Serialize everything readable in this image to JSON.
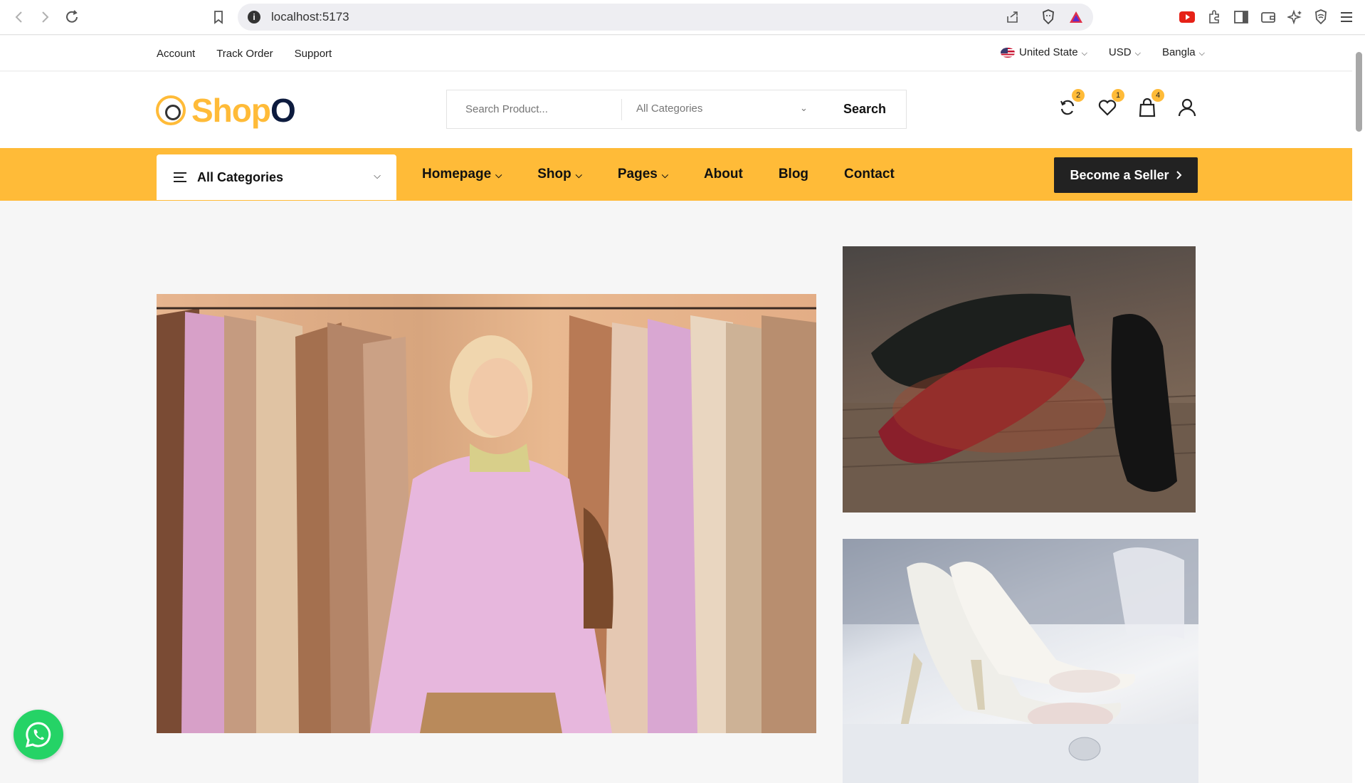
{
  "browser": {
    "url": "localhost:5173"
  },
  "topbar": {
    "links": [
      "Account",
      "Track Order",
      "Support"
    ],
    "country": "United State",
    "currency": "USD",
    "language": "Bangla"
  },
  "header": {
    "logo_text_main": "Shop",
    "logo_text_accent": "O",
    "search_placeholder": "Search Product...",
    "search_category": "All Categories",
    "search_button": "Search",
    "compare_count": "2",
    "wishlist_count": "1",
    "cart_count": "4"
  },
  "navbar": {
    "all_categories": "All Categories",
    "menu": [
      {
        "label": "Homepage",
        "dropdown": true
      },
      {
        "label": "Shop",
        "dropdown": true
      },
      {
        "label": "Pages",
        "dropdown": true
      },
      {
        "label": "About",
        "dropdown": false
      },
      {
        "label": "Blog",
        "dropdown": false
      },
      {
        "label": "Contact",
        "dropdown": false
      }
    ],
    "seller_button": "Become a Seller"
  },
  "colors": {
    "brand_yellow": "#ffbb38",
    "brand_dark": "#0d1b3e",
    "whatsapp_green": "#25d366"
  },
  "icons": {
    "compare": "refresh-icon",
    "wishlist": "heart-icon",
    "cart": "bag-icon",
    "account": "user-icon",
    "chat": "whatsapp-icon"
  }
}
